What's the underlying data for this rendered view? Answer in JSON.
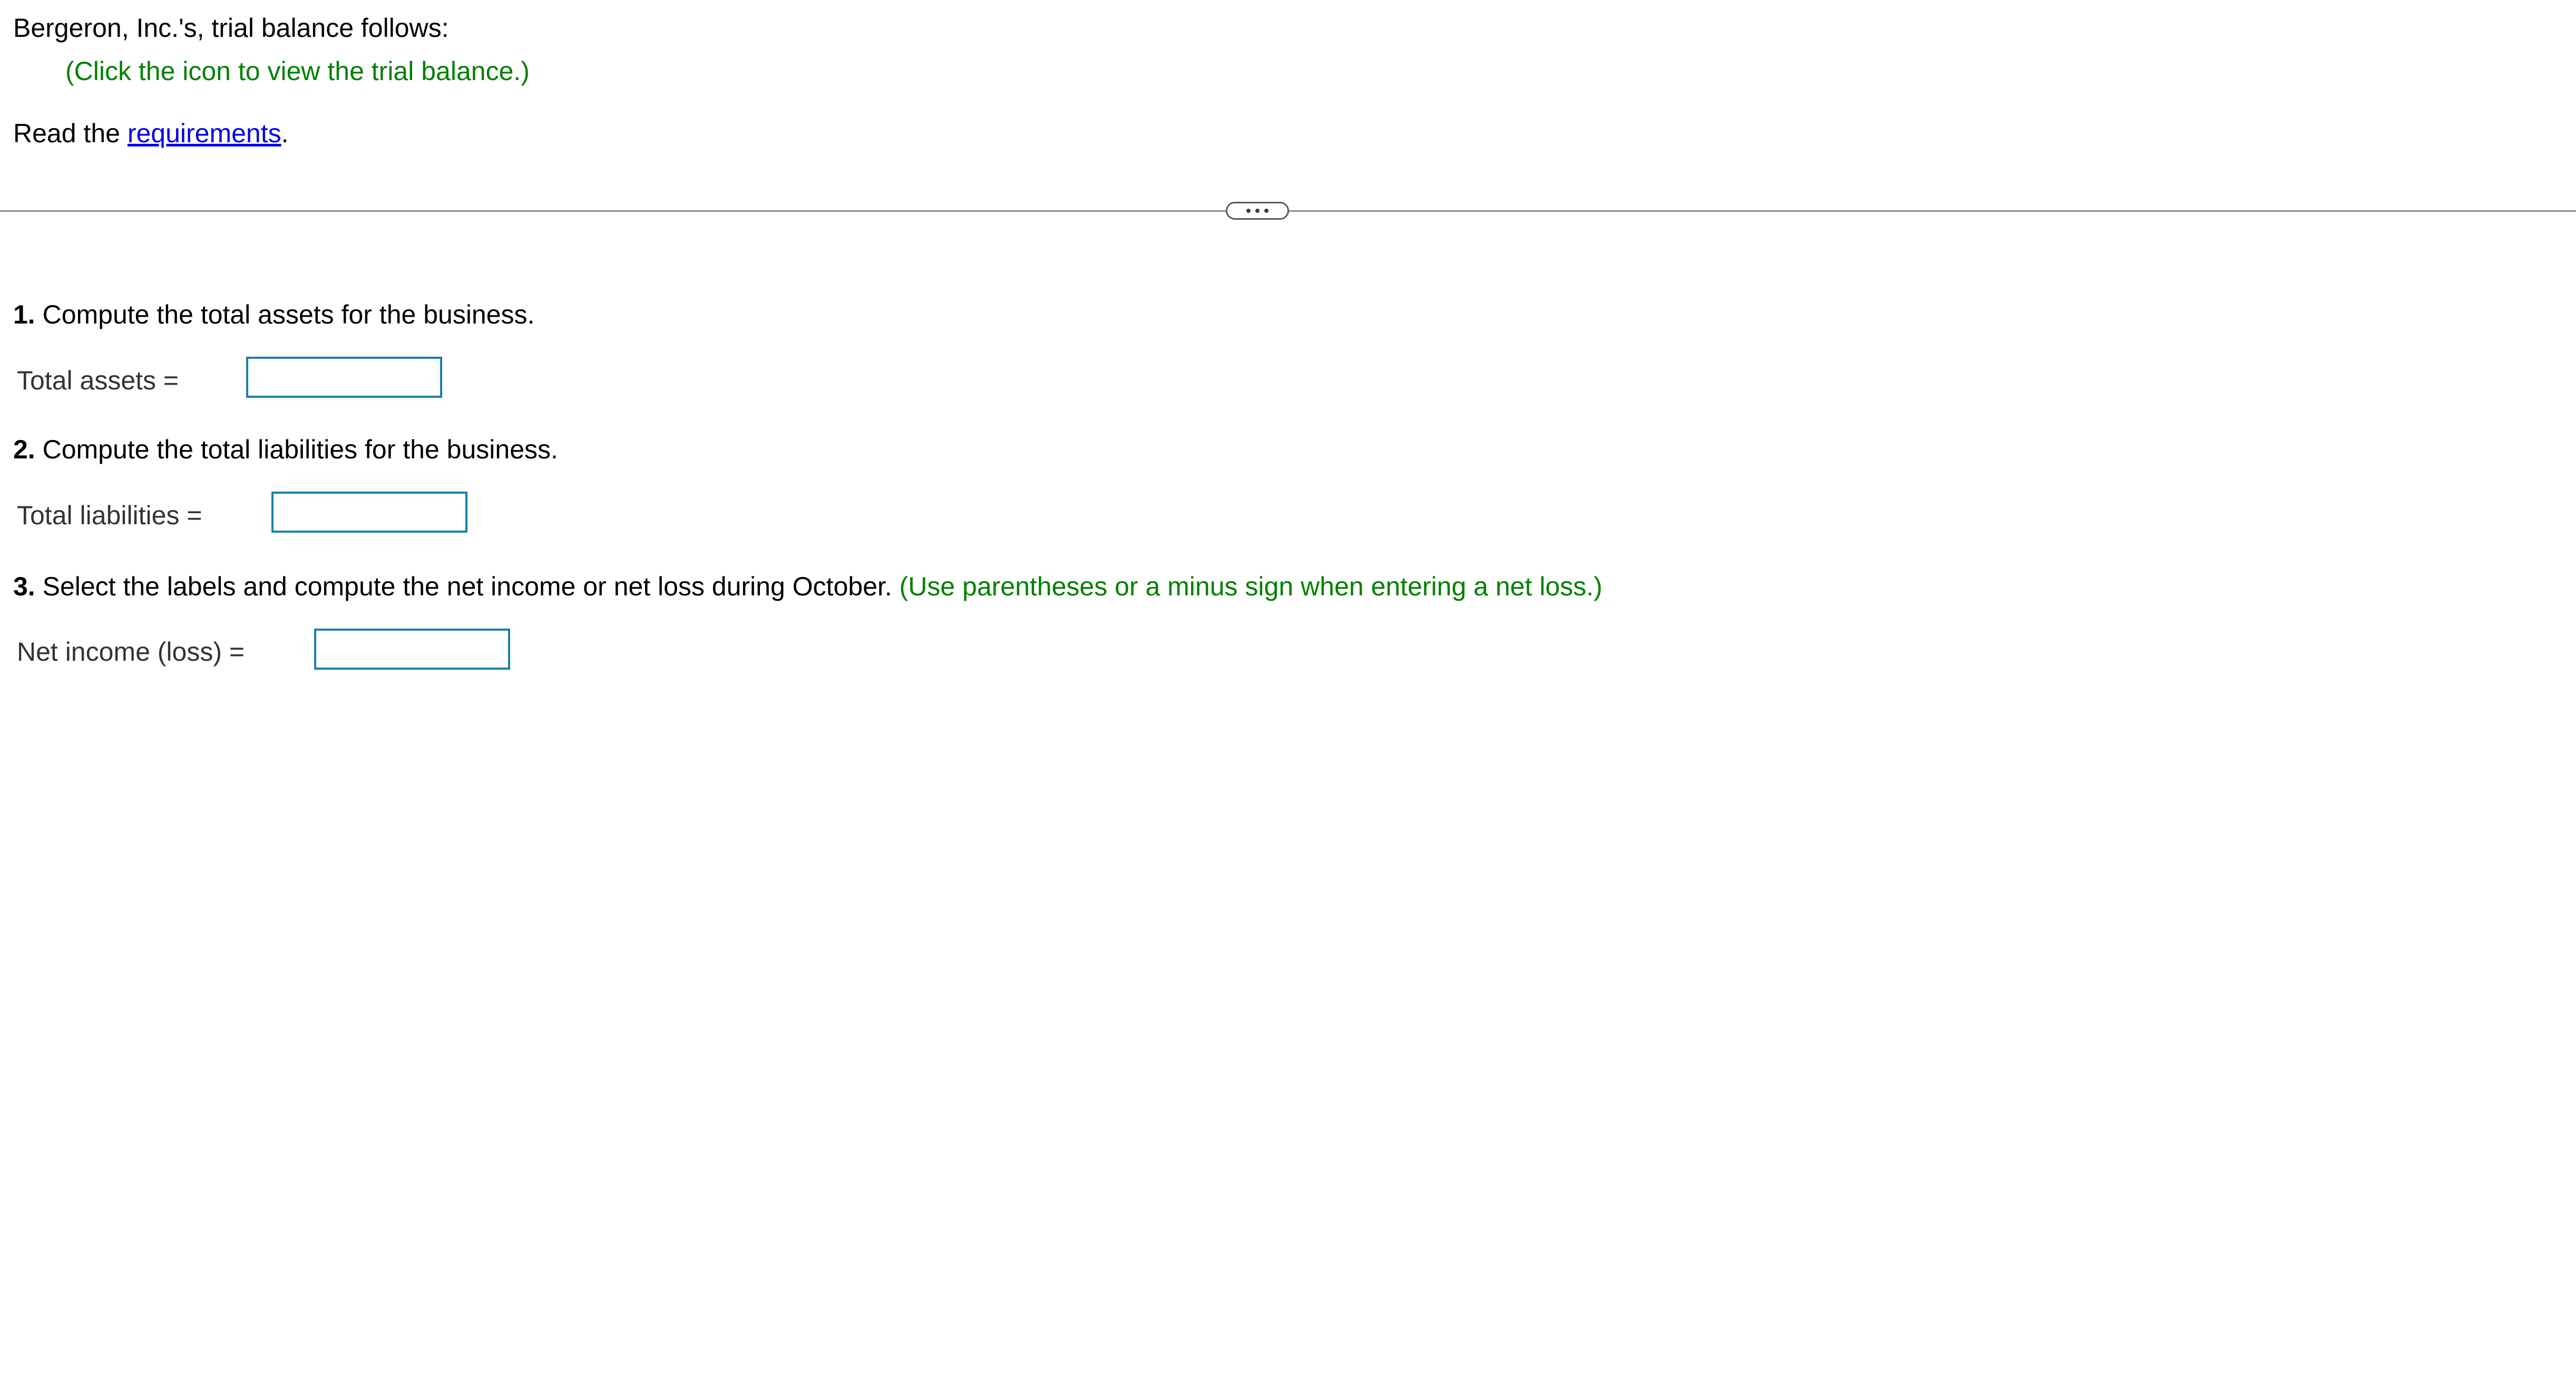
{
  "intro": {
    "text": "Bergeron, Inc.'s, trial balance follows:",
    "hint": "(Click the icon to view the trial balance.)"
  },
  "read": {
    "prefix": "Read the ",
    "link": "requirements",
    "suffix": "."
  },
  "divider": {
    "expander_icon": "ellipsis-icon"
  },
  "questions": [
    {
      "number": "1.",
      "text": " Compute the total assets for the business.",
      "note": "",
      "label": "Total assets =",
      "value": ""
    },
    {
      "number": "2.",
      "text": " Compute the total liabilities for the business.",
      "note": "",
      "label": "Total liabilities =",
      "value": ""
    },
    {
      "number": "3.",
      "text": " Select the labels and compute the net income or net loss during October.",
      "note": " (Use parentheses or a minus sign when entering a net loss.)",
      "label": "Net income (loss) =",
      "value": ""
    }
  ],
  "colors": {
    "instruction_green": "#008000",
    "link_blue": "#0000ee",
    "input_border": "#1a7fa8"
  }
}
